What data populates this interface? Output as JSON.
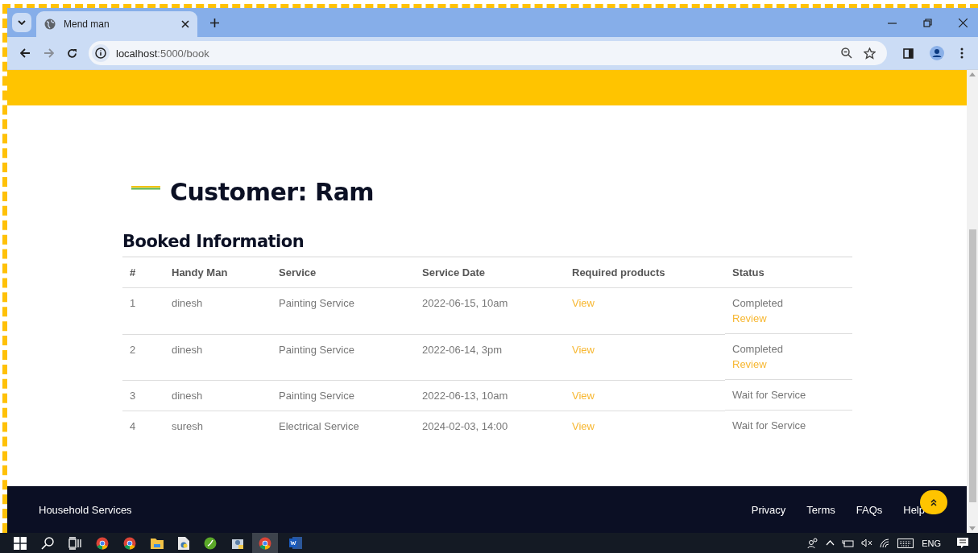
{
  "browser": {
    "tab_title": "Mend man",
    "url_host": "localhost",
    "url_path": ":5000/book"
  },
  "page": {
    "heading": "Customer: Ram",
    "section_title": "Booked Information",
    "table": {
      "columns": [
        "#",
        "Handy Man",
        "Service",
        "Service Date",
        "Required products",
        "Status"
      ],
      "rows": [
        {
          "number": "1",
          "handyman": "dinesh",
          "service": "Painting Service",
          "date": "2022-06-15, 10am",
          "products_link": "View",
          "status": "Completed",
          "review_link": "Review"
        },
        {
          "number": "2",
          "handyman": "dinesh",
          "service": "Painting Service",
          "date": "2022-06-14, 3pm",
          "products_link": "View",
          "status": "Completed",
          "review_link": "Review"
        },
        {
          "number": "3",
          "handyman": "dinesh",
          "service": "Painting Service",
          "date": "2022-06-13, 10am",
          "products_link": "View",
          "status": "Wait for Service"
        },
        {
          "number": "4",
          "handyman": "suresh",
          "service": "Electrical Service",
          "date": "2024-02-03, 14:00",
          "products_link": "View",
          "status": "Wait for Service"
        }
      ]
    }
  },
  "footer": {
    "brand": "Household Services",
    "links": [
      "Privacy",
      "Terms",
      "FAQs",
      "Help"
    ]
  },
  "taskbar": {
    "language": "ENG"
  }
}
